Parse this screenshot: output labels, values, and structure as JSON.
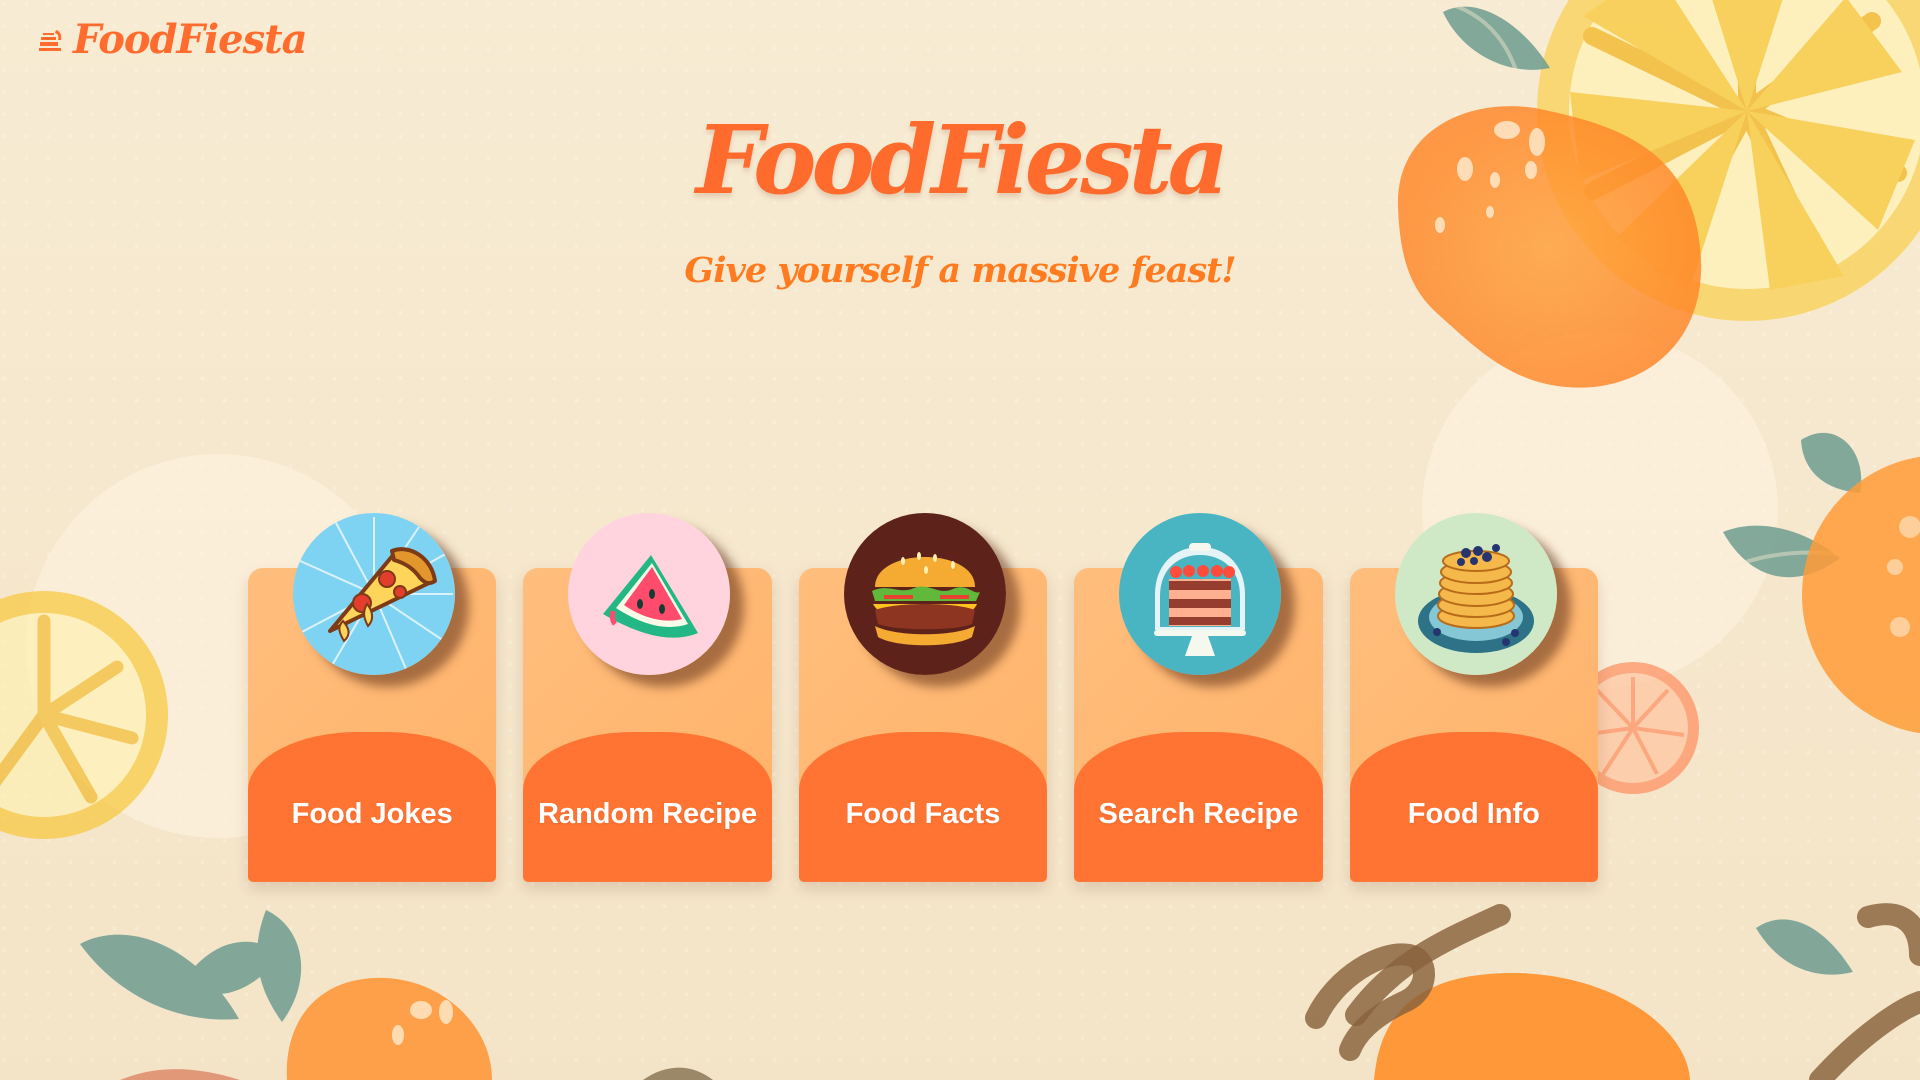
{
  "app": {
    "name": "FoodFiesta",
    "tagline": "Give yourself a massive feast!"
  },
  "cards": [
    {
      "label": "Food Jokes",
      "image_icon": "pizza-slice-icon"
    },
    {
      "label": "Random Recipe",
      "image_icon": "watermelon-slice-icon"
    },
    {
      "label": "Food Facts",
      "image_icon": "burger-icon"
    },
    {
      "label": "Search Recipe",
      "image_icon": "cake-stand-icon"
    },
    {
      "label": "Food Info",
      "image_icon": "pancakes-icon"
    }
  ],
  "colors": {
    "background": "#f6e9cf",
    "accent": "#ff6c2d",
    "card_top": "#ffb46a",
    "card_bottom": "#ff7433",
    "leaf": "#6d9c91",
    "orange": "#ff9c38",
    "lemon": "#f8c736"
  }
}
